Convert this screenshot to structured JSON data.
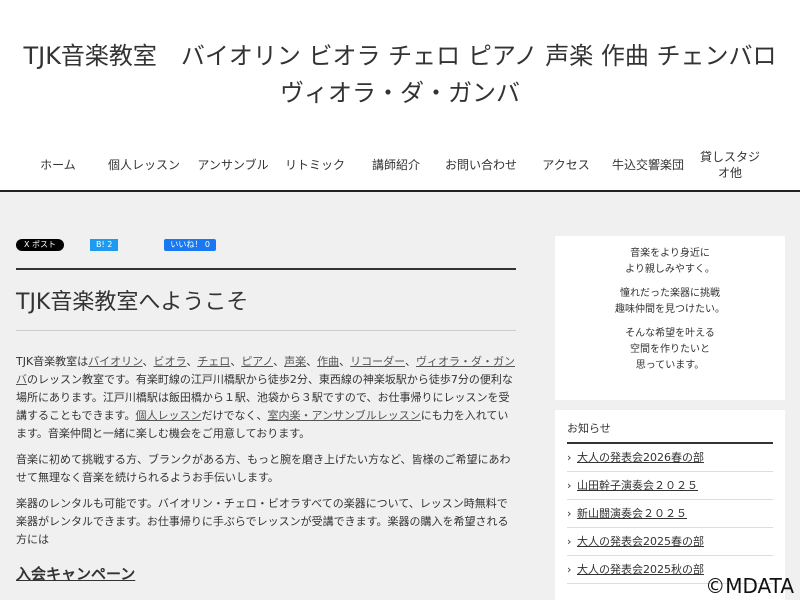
{
  "header": {
    "title_line1": "TJK音楽教室　バイオリン ビオラ チェロ ピアノ 声楽 作曲 チェンバロ",
    "title_line2": "ヴィオラ・ダ・ガンバ"
  },
  "nav": [
    "ホーム",
    "個人レッスン",
    "アンサンブル",
    "リトミック",
    "講師紹介",
    "お問い合わせ",
    "アクセス",
    "牛込交響楽団",
    "貸しスタジオ他"
  ],
  "share": {
    "x_label": "X ポスト",
    "b_label": "B! 2",
    "fb_label": "いいね！ 0"
  },
  "main": {
    "title": "TJK音楽教室へようこそ",
    "p1": {
      "a": "TJK音楽教室は",
      "l1": "バイオリン",
      "s1": "、",
      "l2": "ビオラ",
      "s2": "、",
      "l3": "チェロ",
      "s3": "、",
      "l4": "ピアノ",
      "s4": "、",
      "l5": "声楽",
      "s5": "、",
      "l6": "作曲",
      "s6": "、",
      "l7": "リコーダー",
      "s7": "、",
      "l8": "ヴィオラ・ダ・ガンバ",
      "b": "のレッスン教室です。有楽町線の江戸川橋駅から徒歩2分、東西線の神楽坂駅から徒歩7分の便利な場所にあります。江戸川橋駅は飯田橋から１駅、池袋から３駅ですので、お仕事帰りにレッスンを受講することもできます。",
      "l9": "個人レッスン",
      "c": "だけでなく、",
      "l10": "室内楽・アンサンブルレッスン",
      "d": "にも力を入れています。音楽仲間と一緒に楽しむ機会をご用意しております。"
    },
    "p2": "音楽に初めて挑戦する方、ブランクがある方、もっと腕を磨き上げたい方など、皆様のご希望にあわせて無理なく音楽を続けられるようお手伝いします。",
    "p3": "楽器のレンタルも可能です。バイオリン・チェロ・ビオラすべての楽器について、レッスン時無料で楽器がレンタルできます。お仕事帰りに手ぶらでレッスンが受講できます。楽器の購入を希望される方には",
    "section_heading": "入会キャンペーン"
  },
  "sidebar": {
    "message": [
      "音楽をより身近に",
      "より親しみやすく。",
      "憧れだった楽器に挑戦",
      "趣味仲間を見つけたい。",
      "そんな希望を叶える",
      "空間を作りたいと",
      "思っています。"
    ],
    "news_heading": "お知らせ",
    "news": [
      "大人の発表会2026春の部",
      "山田幹子演奏会２０２５",
      "新山闘演奏会２０２５",
      "大人の発表会2025春の部",
      "大人の発表会2025秋の部"
    ]
  },
  "watermark": "©MDATA"
}
